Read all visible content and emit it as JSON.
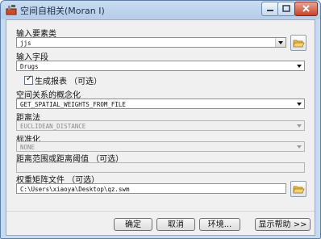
{
  "window": {
    "title": "空间自相关(Moran I)"
  },
  "fields": {
    "input_feature_class": {
      "label": "输入要素类",
      "value": "jjs"
    },
    "input_field": {
      "label": "输入字段",
      "value": "Drugs"
    },
    "generate_report": {
      "label": "生成报表 （可选）",
      "checked": true
    },
    "conceptualization": {
      "label": "空间关系的概念化",
      "value": "GET_SPATIAL_WEIGHTS_FROM_FILE"
    },
    "distance_method": {
      "label": "距离法",
      "value": "EUCLIDEAN_DISTANCE"
    },
    "standardization": {
      "label": "标准化",
      "value": "NONE"
    },
    "distance_threshold": {
      "label": "距离范围或距离阈值 （可选）",
      "value": ""
    },
    "weights_matrix_file": {
      "label": "权重矩阵文件 （可选）",
      "value": "C:\\Users\\xiaoya\\Desktop\\qz.swm"
    }
  },
  "buttons": {
    "ok": "确定",
    "cancel": "取消",
    "environments": "环境...",
    "show_help": "显示帮助 >>"
  },
  "icons": {
    "app": "hammer-toolbox-icon",
    "folder": "open-folder-icon"
  },
  "colors": {
    "titlebar": "#b6cde8",
    "client": "#f0f0f0",
    "close": "#c7432a"
  }
}
